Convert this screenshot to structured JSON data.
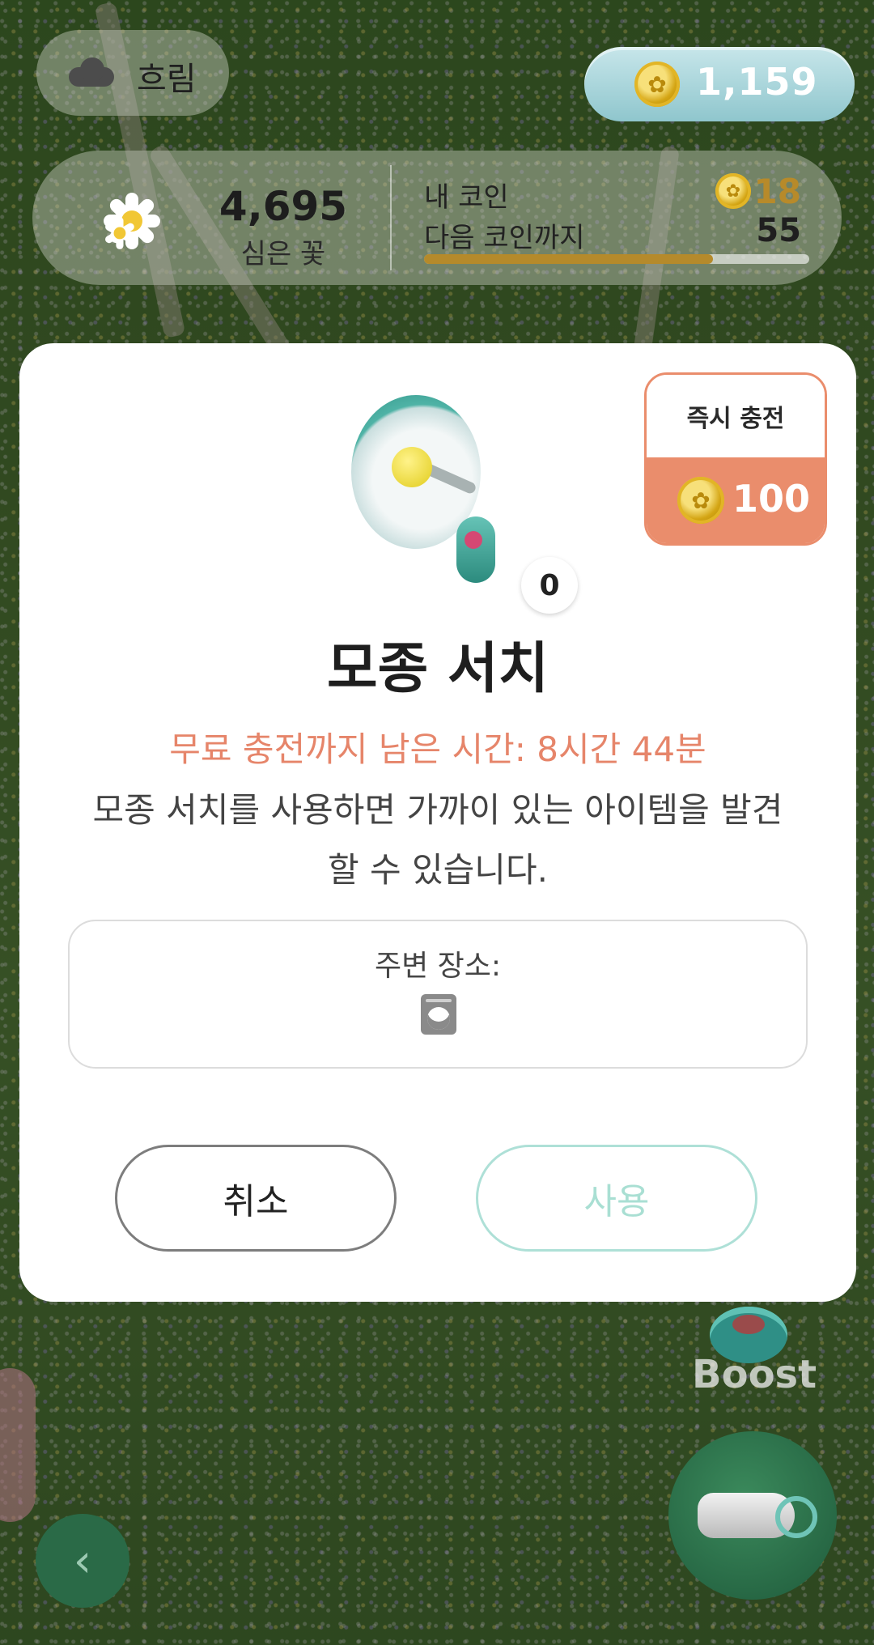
{
  "hud": {
    "weather": "흐림",
    "coins": "1,159",
    "planted_count": "4,695",
    "planted_label": "심은 꽃",
    "my_coin_label": "내 코인",
    "my_coin_value": "18",
    "next_coin_label": "다음 코인까지",
    "next_coin_value": "55",
    "next_coin_progress": 0.75
  },
  "modal": {
    "recharge_label": "즉시 충전",
    "recharge_price": "100",
    "item_count": "0",
    "title": "모종 서치",
    "timer": "무료 충전까지 남은 시간: 8시간 44분",
    "description": "모종 서치를 사용하면 가까이 있는 아이템을 발견할 수 있습니다.",
    "nearby_label": "주변 장소:",
    "nearby_icon": "washing-machine-icon",
    "cancel_label": "취소",
    "use_label": "사용"
  },
  "controls": {
    "boost_label": "Boost",
    "back_icon": "chevron-left-icon"
  },
  "colors": {
    "accent_orange": "#ea8d6c",
    "timer_orange": "#e6856a",
    "teal": "#aee0d7",
    "gold": "#b78a2a"
  }
}
